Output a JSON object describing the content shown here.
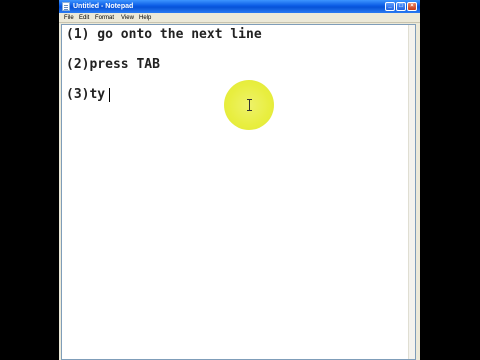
{
  "window": {
    "title": "Untitled - Notepad",
    "buttons": {
      "minimize": "_",
      "maximize": "□",
      "close": "×"
    }
  },
  "menubar": {
    "items": [
      {
        "label": "File"
      },
      {
        "label": "Edit"
      },
      {
        "label": "Format"
      },
      {
        "label": "View"
      },
      {
        "label": "Help"
      }
    ]
  },
  "editor": {
    "lines": [
      "(1) go onto the next line",
      "(2)press TAB",
      "(3)ty"
    ]
  },
  "cursor_highlight": {
    "color": "#e8ee3e"
  },
  "colors": {
    "titlebar": "#0a5be5",
    "menubar": "#ece9d8",
    "editor": "#ffffff"
  }
}
